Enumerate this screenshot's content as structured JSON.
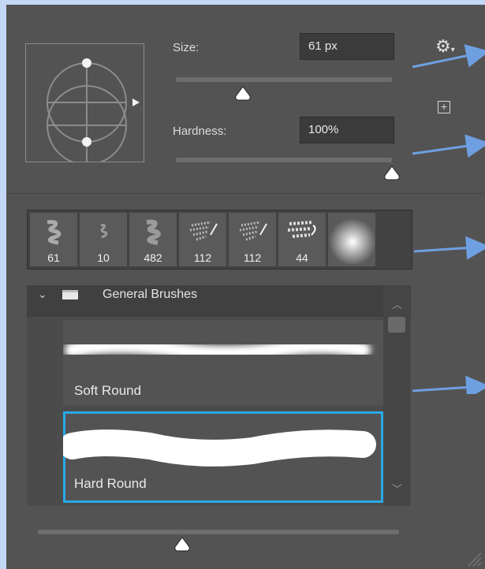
{
  "size": {
    "label": "Size:",
    "value": "61 px",
    "slider_fraction": 0.31
  },
  "hardness": {
    "label": "Hardness:",
    "value": "100%",
    "slider_fraction": 1.0
  },
  "recent_brushes": [
    {
      "size": "61"
    },
    {
      "size": "10"
    },
    {
      "size": "482"
    },
    {
      "size": "112"
    },
    {
      "size": "112"
    },
    {
      "size": "44"
    },
    {
      "size": ""
    }
  ],
  "group": {
    "name": "General Brushes"
  },
  "brushes": [
    {
      "name": "Soft Round",
      "selected": false
    },
    {
      "name": "Hard Round",
      "selected": true
    }
  ],
  "preview_size_slider_fraction": 0.4,
  "colors": {
    "accent": "#29a9e8",
    "arrow": "#6e9fe0",
    "background": "#c4d7f5",
    "panel": "#535353"
  },
  "icons": {
    "settings": "gear-icon",
    "new_preset": "plus-square-icon",
    "folder": "folder-icon",
    "chevron": "chevron-down-icon"
  }
}
